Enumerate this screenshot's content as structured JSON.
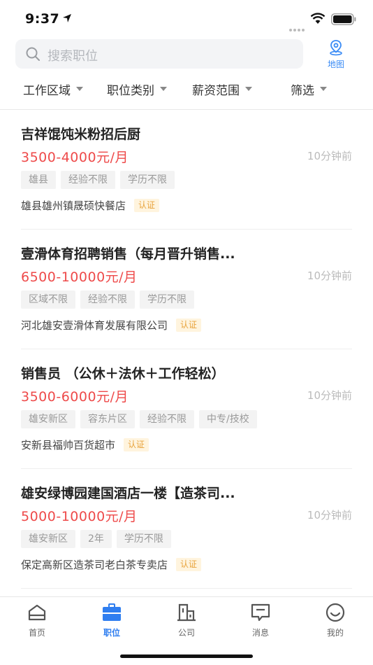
{
  "status_bar": {
    "time": "9:37"
  },
  "search": {
    "placeholder": "搜索职位",
    "map_label": "地图"
  },
  "filters": [
    "工作区域",
    "职位类别",
    "薪资范围",
    "筛选"
  ],
  "jobs": [
    {
      "title": "吉祥馄饨米粉招后厨",
      "salary": "3500-4000元/月",
      "time": "10分钟前",
      "tags": [
        "雄县",
        "经验不限",
        "学历不限"
      ],
      "company": "雄县雄州镇晟硕快餐店",
      "cert": "认证"
    },
    {
      "title": "壹滑体育招聘销售（每月晋升销售...",
      "salary": "6500-10000元/月",
      "time": "10分钟前",
      "tags": [
        "区域不限",
        "经验不限",
        "学历不限"
      ],
      "company": "河北雄安壹滑体育发展有限公司",
      "cert": "认证"
    },
    {
      "title": "销售员 （公休＋法休＋工作轻松）",
      "salary": "3500-6000元/月",
      "time": "10分钟前",
      "tags": [
        "雄安新区",
        "容东片区",
        "经验不限",
        "中专/技校"
      ],
      "company": "安新县福帅百货超市",
      "cert": "认证"
    },
    {
      "title": "雄安绿博园建国酒店一楼【造茶司...",
      "salary": "5000-10000元/月",
      "time": "10分钟前",
      "tags": [
        "雄安新区",
        "2年",
        "学历不限"
      ],
      "company": "保定高新区造茶司老白茶专卖店",
      "cert": "认证"
    }
  ],
  "tabs": [
    {
      "label": "首页",
      "icon": "home-icon",
      "active": false
    },
    {
      "label": "职位",
      "icon": "briefcase-icon",
      "active": true
    },
    {
      "label": "公司",
      "icon": "building-icon",
      "active": false
    },
    {
      "label": "消息",
      "icon": "message-icon",
      "active": false
    },
    {
      "label": "我的",
      "icon": "smile-icon",
      "active": false
    }
  ],
  "colors": {
    "accent": "#2f7ef0",
    "salary": "#ee4a4a",
    "cert_bg": "#fff4de",
    "cert_text": "#e8a33c"
  }
}
